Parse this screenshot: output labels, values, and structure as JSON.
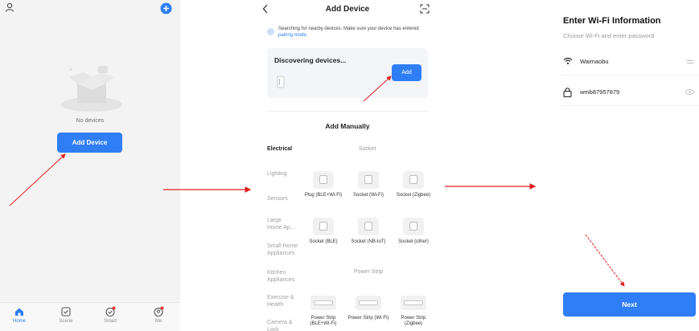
{
  "colors": {
    "accent": "#2f7ef6",
    "arrow": "#e02020",
    "badge": "#e53935"
  },
  "home": {
    "no_devices": "No devices",
    "add_button": "Add Device",
    "tabs": [
      {
        "label": "Home",
        "icon": "home-icon"
      },
      {
        "label": "Scene",
        "icon": "scene-check-icon"
      },
      {
        "label": "Smart",
        "icon": "smart-icon"
      },
      {
        "label": "Me",
        "icon": "me-icon"
      }
    ]
  },
  "add_device": {
    "title": "Add Device",
    "notice_prefix": "Searching for nearby devices. Make sure your device has entered ",
    "notice_link": "pairing mode",
    "notice_suffix": ".",
    "discovering": "Discovering devices...",
    "add_label": "Add",
    "manual_title": "Add Manually",
    "categories": [
      "Electrical",
      "Lighting",
      "Sensors",
      "Large Home Ap...",
      "Small Home Appliances",
      "Kitchen Appliances",
      "Exercise & Health",
      "Camera & Lock"
    ],
    "section_socket": "Socket",
    "section_power_strip": "Power Strip",
    "sockets": [
      {
        "label": "Plug (BLE+Wi-Fi)"
      },
      {
        "label": "Socket (Wi-Fi)"
      },
      {
        "label": "Socket (Zigbee)"
      },
      {
        "label": "Socket (BLE)"
      },
      {
        "label": "Socket (NB-IoT)"
      },
      {
        "label": "Socket (other)"
      }
    ],
    "strips": [
      {
        "label": "Power Strip (BLE+Wi-Fi)"
      },
      {
        "label": "Power Strip (Wi-Fi)"
      },
      {
        "label": "Power Strip (Zigbee)"
      }
    ]
  },
  "wifi": {
    "title": "Enter Wi-Fi Information",
    "subtitle": "Choose Wi-Fi and enter password",
    "ssid": "Waimaobu",
    "password": "wmb87957879",
    "next_label": "Next"
  }
}
